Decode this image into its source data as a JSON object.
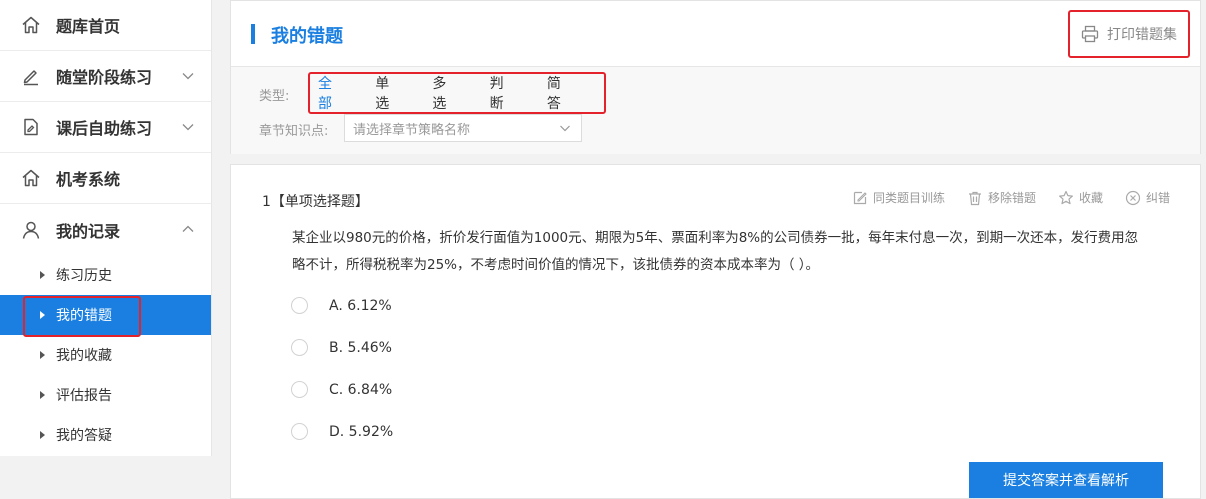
{
  "sidebar": {
    "items": [
      {
        "label": "题库首页",
        "icon": "home-icon"
      },
      {
        "label": "随堂阶段练习",
        "icon": "pencil-icon"
      },
      {
        "label": "课后自助练习",
        "icon": "document-edit-icon"
      },
      {
        "label": "机考系统",
        "icon": "home-icon"
      },
      {
        "label": "我的记录",
        "icon": "user-icon"
      }
    ],
    "sub_items": [
      {
        "label": "练习历史"
      },
      {
        "label": "我的错题"
      },
      {
        "label": "我的收藏"
      },
      {
        "label": "评估报告"
      },
      {
        "label": "我的答疑"
      }
    ],
    "active_sub": "我的错题"
  },
  "header": {
    "title": "我的错题",
    "print_label": "打印错题集"
  },
  "filters": {
    "type_label": "类型:",
    "types": [
      "全部",
      "单选",
      "多选",
      "判断",
      "简答"
    ],
    "active_type": "全部",
    "chapter_label": "章节知识点:",
    "chapter_placeholder": "请选择章节策略名称"
  },
  "question": {
    "number": "1",
    "type": "【单项选择题】",
    "actions": [
      {
        "label": "同类题目训练",
        "icon": "edit-icon"
      },
      {
        "label": "移除错题",
        "icon": "trash-icon"
      },
      {
        "label": "收藏",
        "icon": "star-icon"
      },
      {
        "label": "纠错",
        "icon": "close-circle-icon"
      }
    ],
    "stem": "某企业以980元的价格，折价发行面值为1000元、期限为5年、票面利率为8%的公司债券一批，每年末付息一次，到期一次还本，发行费用忽略不计，所得税税率为25%，不考虑时间价值的情况下，该批债券的资本成本率为（    ）。",
    "options": [
      {
        "text": "A.  6.12%"
      },
      {
        "text": "B.  5.46%"
      },
      {
        "text": "C.  6.84%"
      },
      {
        "text": "D.  5.92%"
      }
    ],
    "submit_label": "提交答案并查看解析"
  },
  "colors": {
    "accent": "#1a7fe0",
    "highlight_border": "#e3222c"
  }
}
